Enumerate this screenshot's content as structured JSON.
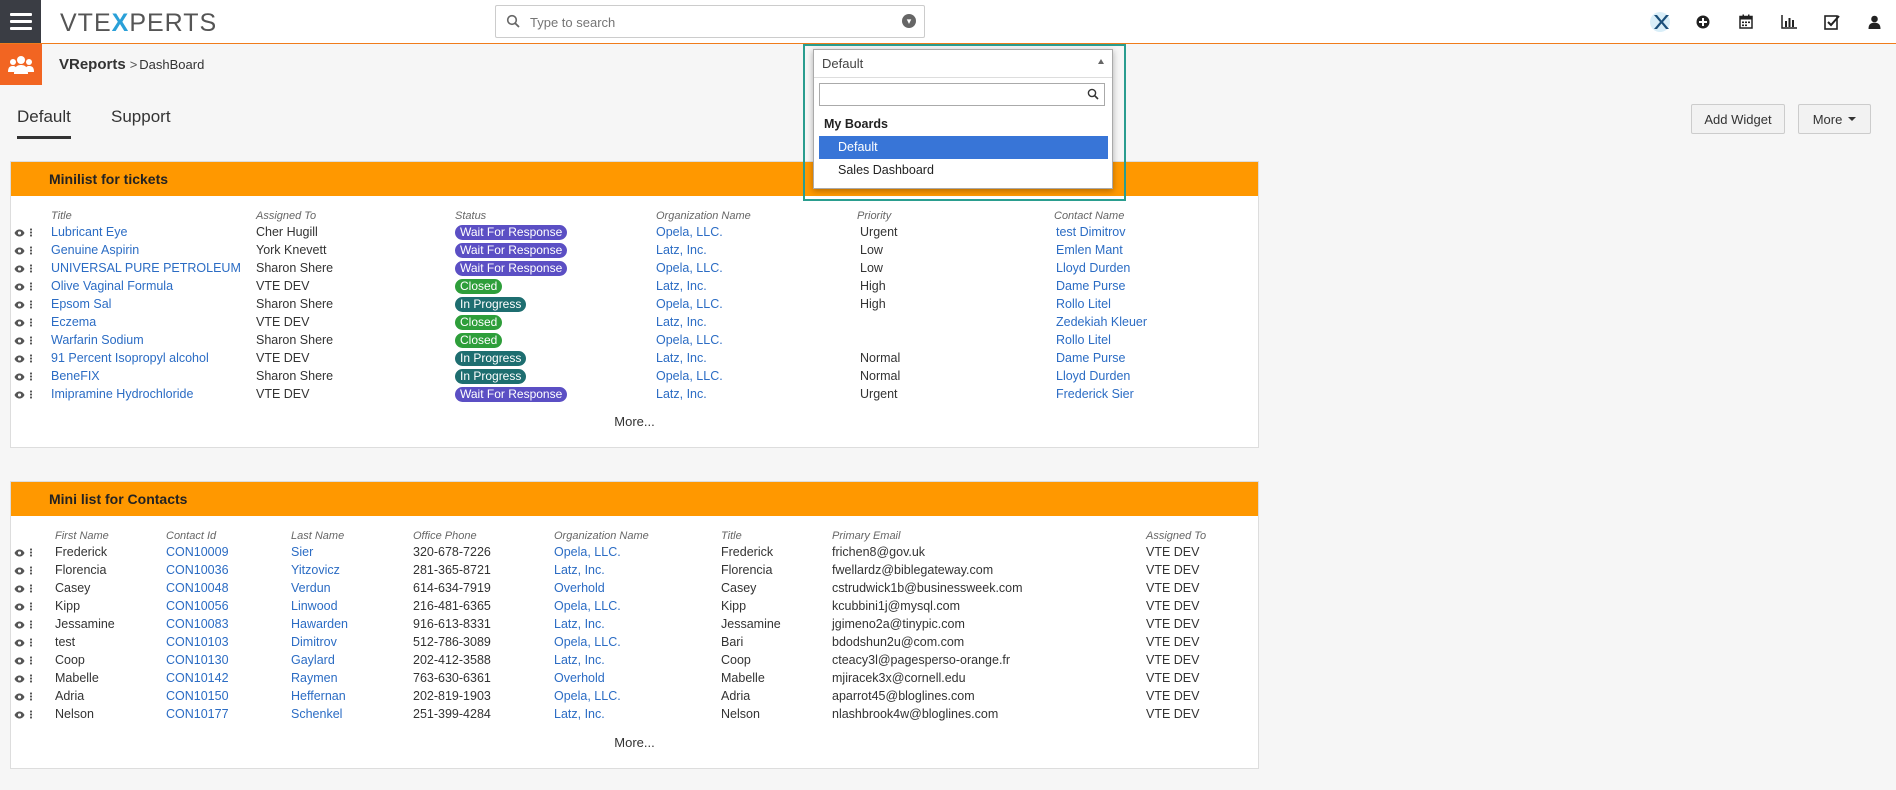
{
  "brand": {
    "logo_pre": "VTE",
    "logo_x": "X",
    "logo_post": "PERTS"
  },
  "search": {
    "placeholder": "Type to search"
  },
  "breadcrumb": {
    "module": "VReports",
    "separator": ">",
    "page": "DashBoard"
  },
  "tabs": [
    {
      "label": "Default",
      "active": true
    },
    {
      "label": "Support",
      "active": false
    }
  ],
  "buttons": {
    "add_widget": "Add Widget",
    "more": "More"
  },
  "board_dropdown": {
    "selected": "Default",
    "search_value": "",
    "group": "My Boards",
    "options": [
      "Default",
      "Sales Dashboard"
    ],
    "highlighted": "Default"
  },
  "colors": {
    "accent": "#ff9800",
    "top_border": "#f07c1b",
    "link": "#2b6cc4",
    "wait": "#5b4fc4",
    "closed": "#2e9e3a",
    "progress": "#1e6e70",
    "highlight_box": "#2a9d8f",
    "module_icon": "#f26522"
  },
  "tickets_widget": {
    "title": "Minilist for tickets",
    "columns": [
      "Title",
      "Assigned To",
      "Status",
      "Organization Name",
      "Priority",
      "Contact Name"
    ],
    "rows": [
      {
        "title": "Lubricant Eye",
        "assigned": "Cher Hugill",
        "status": "Wait For Response",
        "org": "Opela, LLC.",
        "priority": "Urgent",
        "contact": "test Dimitrov"
      },
      {
        "title": "Genuine Aspirin",
        "assigned": "York Knevett",
        "status": "Wait For Response",
        "org": "Latz, Inc.",
        "priority": "Low",
        "contact": "Emlen Mant"
      },
      {
        "title": "UNIVERSAL PURE PETROLEUM",
        "assigned": "Sharon Shere",
        "status": "Wait For Response",
        "org": "Opela, LLC.",
        "priority": "Low",
        "contact": "Lloyd Durden"
      },
      {
        "title": "Olive Vaginal Formula",
        "assigned": "VTE DEV",
        "status": "Closed",
        "org": "Latz, Inc.",
        "priority": "High",
        "contact": "Dame Purse"
      },
      {
        "title": "Epsom Sal",
        "assigned": "Sharon Shere",
        "status": "In Progress",
        "org": "Opela, LLC.",
        "priority": "High",
        "contact": "Rollo Litel"
      },
      {
        "title": "Eczema",
        "assigned": "VTE DEV",
        "status": "Closed",
        "org": "Latz, Inc.",
        "priority": "",
        "contact": "Zedekiah Kleuer"
      },
      {
        "title": "Warfarin Sodium",
        "assigned": "Sharon Shere",
        "status": "Closed",
        "org": "Opela, LLC.",
        "priority": "",
        "contact": "Rollo Litel"
      },
      {
        "title": "91 Percent Isopropyl alcohol",
        "assigned": "VTE DEV",
        "status": "In Progress",
        "org": "Latz, Inc.",
        "priority": "Normal",
        "contact": "Dame Purse"
      },
      {
        "title": "BeneFIX",
        "assigned": "Sharon Shere",
        "status": "In Progress",
        "org": "Opela, LLC.",
        "priority": "Normal",
        "contact": "Lloyd Durden"
      },
      {
        "title": "Imipramine Hydrochloride",
        "assigned": "VTE DEV",
        "status": "Wait For Response",
        "org": "Latz, Inc.",
        "priority": "Urgent",
        "contact": "Frederick Sier"
      }
    ],
    "more": "More..."
  },
  "contacts_widget": {
    "title": "Mini list for Contacts",
    "columns": [
      "First Name",
      "Contact Id",
      "Last Name",
      "Office Phone",
      "Organization Name",
      "Title",
      "Primary Email",
      "Assigned To"
    ],
    "rows": [
      {
        "first": "Frederick",
        "id": "CON10009",
        "last": "Sier",
        "phone": "320-678-7226",
        "org": "Opela, LLC.",
        "title": "Frederick",
        "email": "frichen8@gov.uk",
        "assigned": "VTE DEV"
      },
      {
        "first": "Florencia",
        "id": "CON10036",
        "last": "Yitzovicz",
        "phone": "281-365-8721",
        "org": "Latz, Inc.",
        "title": "Florencia",
        "email": "fwellardz@biblegateway.com",
        "assigned": "VTE DEV"
      },
      {
        "first": "Casey",
        "id": "CON10048",
        "last": "Verdun",
        "phone": "614-634-7919",
        "org": "Overhold",
        "title": "Casey",
        "email": "cstrudwick1b@businessweek.com",
        "assigned": "VTE DEV"
      },
      {
        "first": "Kipp",
        "id": "CON10056",
        "last": "Linwood",
        "phone": "216-481-6365",
        "org": "Opela, LLC.",
        "title": "Kipp",
        "email": "kcubbini1j@mysql.com",
        "assigned": "VTE DEV"
      },
      {
        "first": "Jessamine",
        "id": "CON10083",
        "last": "Hawarden",
        "phone": "916-613-8331",
        "org": "Latz, Inc.",
        "title": "Jessamine",
        "email": "jgimeno2a@tinypic.com",
        "assigned": "VTE DEV"
      },
      {
        "first": "test",
        "id": "CON10103",
        "last": "Dimitrov",
        "phone": "512-786-3089",
        "org": "Opela, LLC.",
        "title": "Bari",
        "email": "bdodshun2u@com.com",
        "assigned": "VTE DEV"
      },
      {
        "first": "Coop",
        "id": "CON10130",
        "last": "Gaylard",
        "phone": "202-412-3588",
        "org": "Latz, Inc.",
        "title": "Coop",
        "email": "cteacy3l@pagesperso-orange.fr",
        "assigned": "VTE DEV"
      },
      {
        "first": "Mabelle",
        "id": "CON10142",
        "last": "Raymen",
        "phone": "763-630-6361",
        "org": "Overhold",
        "title": "Mabelle",
        "email": "mjiracek3x@cornell.edu",
        "assigned": "VTE DEV"
      },
      {
        "first": "Adria",
        "id": "CON10150",
        "last": "Heffernan",
        "phone": "202-819-1903",
        "org": "Opela, LLC.",
        "title": "Adria",
        "email": "aparrot45@bloglines.com",
        "assigned": "VTE DEV"
      },
      {
        "first": "Nelson",
        "id": "CON10177",
        "last": "Schenkel",
        "phone": "251-399-4284",
        "org": "Latz, Inc.",
        "title": "Nelson",
        "email": "nlashbrook4w@bloglines.com",
        "assigned": "VTE DEV"
      }
    ],
    "more": "More..."
  },
  "icons": {
    "top": [
      "vtexperts-x-icon",
      "plus-circle-icon",
      "calendar-icon",
      "bar-chart-icon",
      "checkbox-icon",
      "user-icon"
    ],
    "row_actions": [
      "eye-icon",
      "kebab-icon"
    ]
  }
}
